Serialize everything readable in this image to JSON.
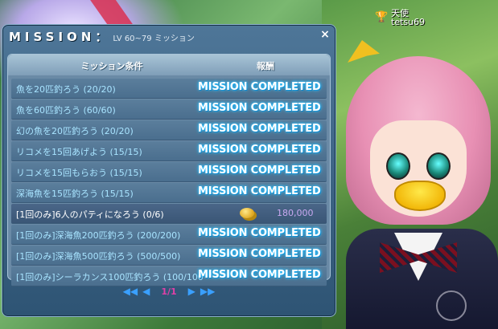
{
  "player": {
    "title": "天使",
    "name": "tetsu69"
  },
  "window": {
    "title": "MISSION：",
    "subtitle": "LV 60~79 ミッション",
    "close_label": "×"
  },
  "columns": {
    "condition": "ミッション条件",
    "reward": "報酬"
  },
  "missions": [
    {
      "condition": "魚を20匹釣ろう (20/20)",
      "status": "MISSION COMPLETED"
    },
    {
      "condition": "魚を60匹釣ろう (60/60)",
      "status": "MISSION COMPLETED"
    },
    {
      "condition": "幻の魚を20匹釣ろう (20/20)",
      "status": "MISSION COMPLETED"
    },
    {
      "condition": "リコメを15回あげよう (15/15)",
      "status": "MISSION COMPLETED"
    },
    {
      "condition": "リコメを15回もらおう (15/15)",
      "status": "MISSION COMPLETED"
    },
    {
      "condition": "深海魚を15匹釣ろう (15/15)",
      "status": "MISSION COMPLETED"
    },
    {
      "condition": "[1回のみ]6人のパティになろう (0/6)",
      "status": "",
      "reward": "180,000"
    },
    {
      "condition": "[1回のみ]深海魚200匹釣ろう (200/200)",
      "status": "MISSION COMPLETED"
    },
    {
      "condition": "[1回のみ]深海魚500匹釣ろう (500/500)",
      "status": "MISSION COMPLETED"
    },
    {
      "condition": "[1回のみ]シーラカンス100匹釣ろう (100/100)",
      "status": "MISSION COMPLETED"
    }
  ],
  "pager": {
    "first": "◀◀",
    "prev": "◀",
    "page": "1/1",
    "next": "▶",
    "last": "▶▶"
  },
  "icons": {
    "close": "close-icon",
    "coin": "coin-icon",
    "trophy": "trophy-icon"
  },
  "colors": {
    "completed_glow": "#2cc0ff",
    "reward_text": "#c8a8f0",
    "page_text": "#e040a8"
  }
}
